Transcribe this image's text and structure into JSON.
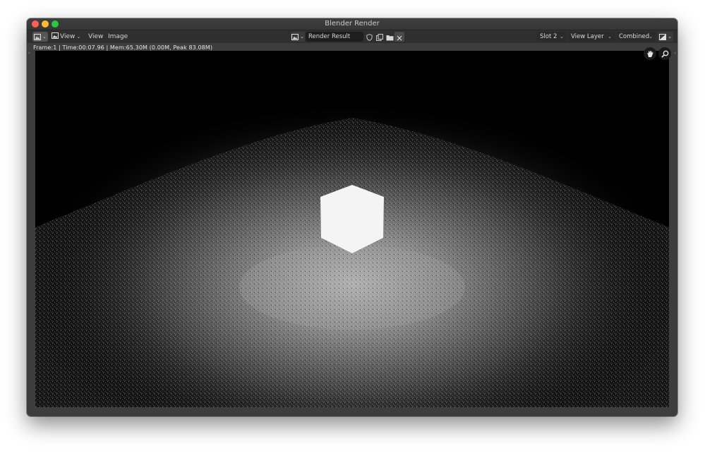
{
  "window": {
    "title": "Blender Render"
  },
  "header": {
    "editor_type_icon": "image-editor-icon",
    "view_mode_icon": "image-mode-icon",
    "view_mode_label": "View",
    "menus": [
      "View",
      "Image"
    ],
    "image_browse_icon": "image-browse-icon",
    "image_name": "Render Result",
    "fake_user_icon": "shield-icon",
    "new_image_icon": "duplicate-icon",
    "open_image_icon": "folder-icon",
    "unlink_icon": "close-icon",
    "slot": "Slot 2",
    "view_layer": "View Layer",
    "pass": "Combined",
    "display_channels_icon": "display-channels-icon"
  },
  "status_line": "Frame:1 | Time:00:07.96 | Mem:65.30M (0.00M, Peak 83.08M)",
  "gizmos": {
    "pan_icon": "hand-icon",
    "zoom_icon": "zoom-icon"
  },
  "render": {
    "description_icon": "render-result-image",
    "background_color": "#000000",
    "cube_color": "#f4f4f4",
    "floor_glow_color": "#bdbdbd"
  }
}
